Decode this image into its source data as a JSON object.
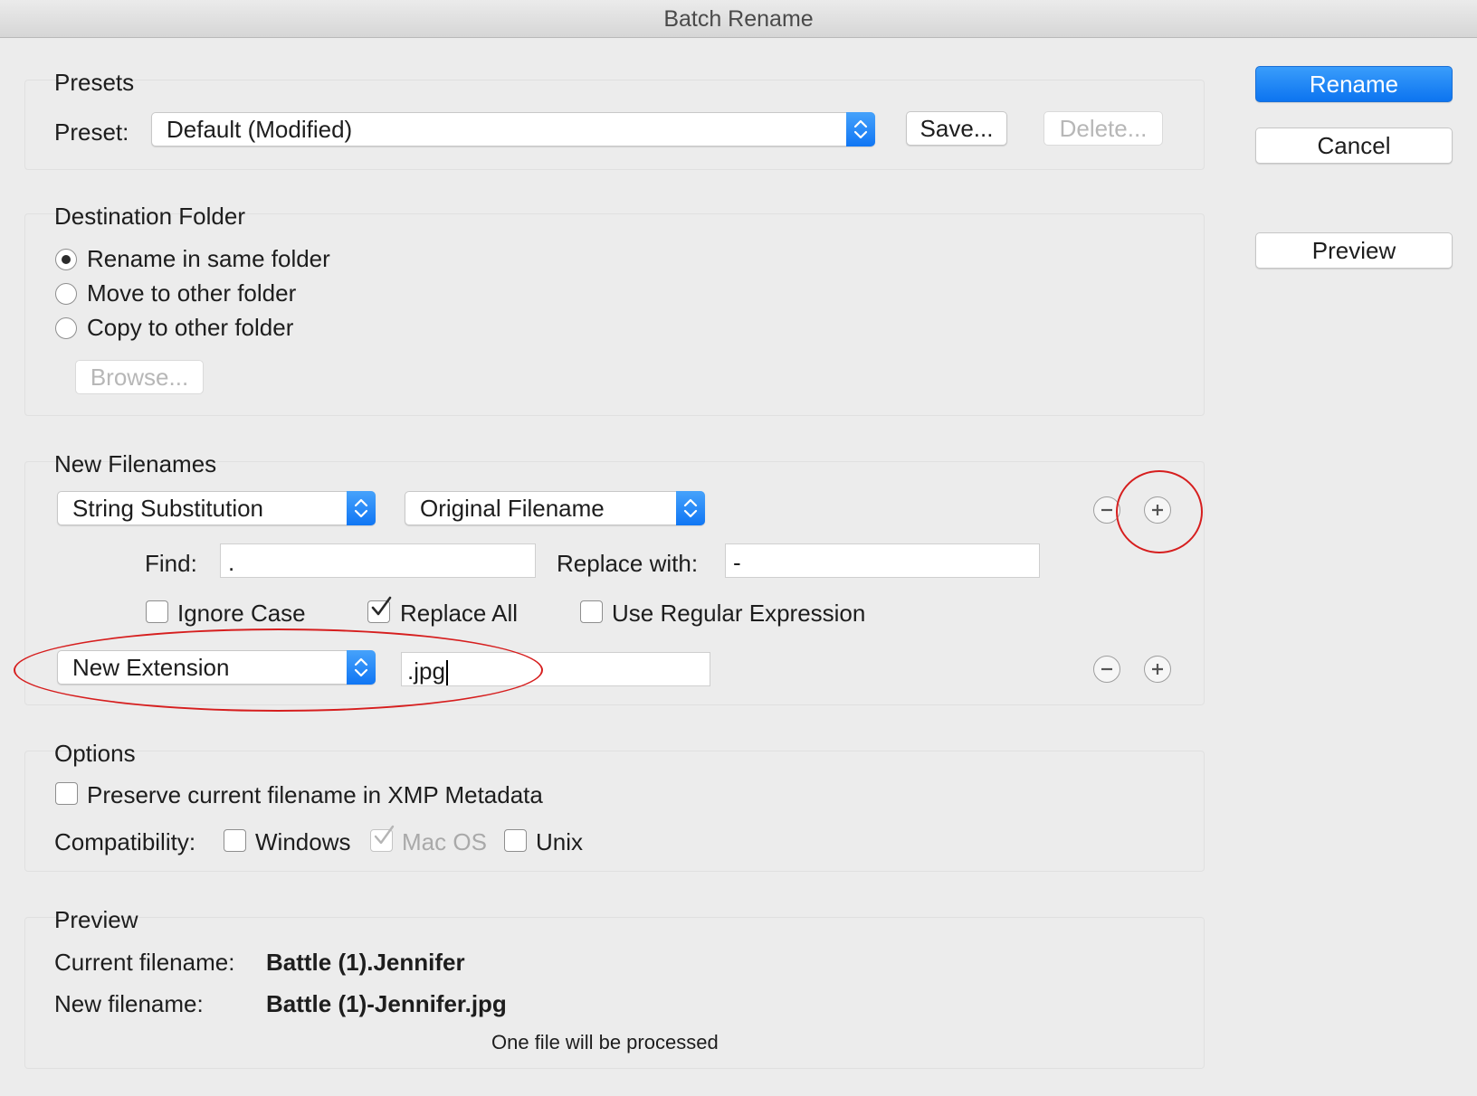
{
  "window": {
    "title": "Batch Rename"
  },
  "side_buttons": {
    "rename": "Rename",
    "cancel": "Cancel",
    "preview": "Preview"
  },
  "presets": {
    "heading": "Presets",
    "preset_label": "Preset:",
    "preset_value": "Default (Modified)",
    "save": "Save...",
    "delete": "Delete..."
  },
  "destination": {
    "heading": "Destination Folder",
    "options": [
      {
        "label": "Rename in same folder",
        "selected": true
      },
      {
        "label": "Move to other folder",
        "selected": false
      },
      {
        "label": "Copy to other folder",
        "selected": false
      }
    ],
    "browse": "Browse..."
  },
  "new_filenames": {
    "heading": "New Filenames",
    "rule1": {
      "type": "String Substitution",
      "source": "Original Filename",
      "find_label": "Find:",
      "find_value": ".",
      "replace_label": "Replace with:",
      "replace_value": "-",
      "ignore_case": {
        "label": "Ignore Case",
        "checked": false
      },
      "replace_all": {
        "label": "Replace All",
        "checked": true
      },
      "use_regex": {
        "label": "Use Regular Expression",
        "checked": false
      }
    },
    "rule2": {
      "type": "New Extension",
      "value": ".jpg"
    },
    "annotation_color": "#d61e1e"
  },
  "options": {
    "heading": "Options",
    "preserve_xmp": {
      "label": "Preserve current filename in XMP Metadata",
      "checked": false
    },
    "compat_label": "Compatibility:",
    "windows": {
      "label": "Windows",
      "checked": false
    },
    "macos": {
      "label": "Mac OS",
      "checked": true,
      "disabled": true
    },
    "unix": {
      "label": "Unix",
      "checked": false
    }
  },
  "preview": {
    "heading": "Preview",
    "current_label": "Current filename:",
    "current_value": "Battle (1).Jennifer",
    "new_label": "New filename:",
    "new_value": "Battle (1)-Jennifer.jpg",
    "status": "One file will be processed"
  },
  "colors": {
    "accent": "#1076f4",
    "window_bg": "#ececec"
  }
}
